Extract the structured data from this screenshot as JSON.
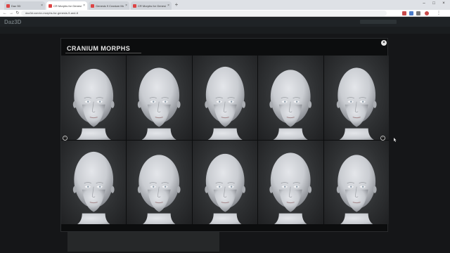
{
  "browser": {
    "tabs": [
      {
        "title": "Daz 3D"
      },
      {
        "title": "CR Morphs for Genesis 9 & 8 M..."
      },
      {
        "title": "Genesis 9 Cranium Morphs | Da..."
      },
      {
        "title": "CR Morphs for Genesis 9 & 8 M..."
      }
    ],
    "address": "daz3d.com/cr-morphs-for-genesis-9-and-8"
  },
  "site": {
    "logo": "Daz3D"
  },
  "modal": {
    "title": "CRANIUM MORPHS",
    "thumbnails": [
      {
        "variant": "a"
      },
      {
        "variant": "b"
      },
      {
        "variant": "c"
      },
      {
        "variant": "d"
      },
      {
        "variant": "e"
      },
      {
        "variant": "f"
      },
      {
        "variant": "g"
      },
      {
        "variant": "h"
      },
      {
        "variant": "i"
      },
      {
        "variant": "j"
      }
    ]
  },
  "icons": {
    "close": "close-icon",
    "prev": "chevron-left-icon",
    "next": "chevron-right-icon"
  },
  "colors": {
    "modal_bg": "#0c0d0e",
    "head_skin": "#c9ccd1",
    "page_bg": "#151618"
  }
}
